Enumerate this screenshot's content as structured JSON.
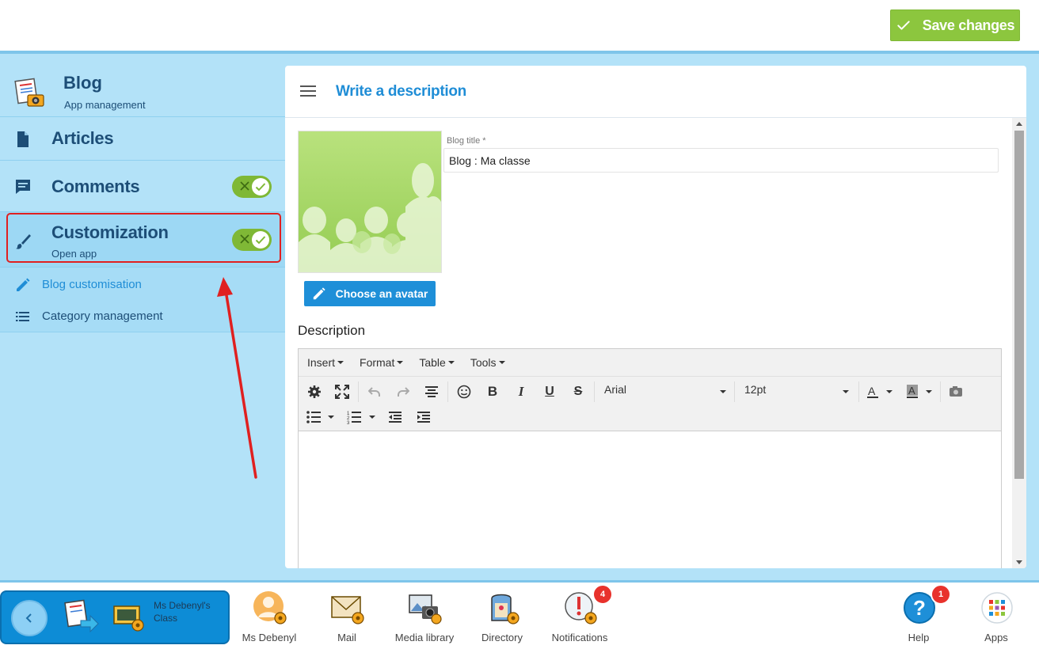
{
  "header": {
    "save_label": "Save changes"
  },
  "sidebar": {
    "app_title": "Blog",
    "app_subtitle": "App management",
    "items": [
      {
        "label": "Articles"
      },
      {
        "label": "Comments",
        "toggle_on": true
      },
      {
        "label": "Customization",
        "sublabel": "Open app",
        "toggle_on": true
      }
    ],
    "subitems": [
      {
        "label": "Blog customisation",
        "active": true
      },
      {
        "label": "Category management",
        "active": false
      }
    ]
  },
  "panel": {
    "title": "Write a description",
    "avatar_button": "Choose an avatar",
    "blog_title_label": "Blog title *",
    "blog_title_value": "Blog : Ma classe",
    "description_label": "Description"
  },
  "editor": {
    "menus": [
      "Insert",
      "Format",
      "Table",
      "Tools"
    ],
    "font_family": "Arial",
    "font_size": "12pt",
    "toolbar_icons": [
      "settings-icon",
      "fullscreen-icon",
      "undo-icon",
      "redo-icon",
      "align-center-icon",
      "emoji-icon",
      "bold-icon",
      "italic-icon",
      "underline-icon",
      "strikethrough-icon",
      "text-color-icon",
      "background-color-icon",
      "image-icon",
      "bullet-list-icon",
      "numbered-list-icon",
      "outdent-icon",
      "indent-icon"
    ]
  },
  "dock": {
    "class_name": "Ms Debenyl's Class",
    "items": [
      {
        "label": "Ms Debenyl",
        "icon": "user-avatar-icon"
      },
      {
        "label": "Mail",
        "icon": "mail-icon"
      },
      {
        "label": "Media library",
        "icon": "media-library-icon"
      },
      {
        "label": "Directory",
        "icon": "directory-icon"
      },
      {
        "label": "Notifications",
        "icon": "notifications-icon",
        "badge": "4"
      },
      {
        "label": "Help",
        "icon": "help-icon",
        "badge": "1"
      },
      {
        "label": "Apps",
        "icon": "apps-grid-icon"
      }
    ]
  },
  "colors": {
    "accent_green": "#8cc63e",
    "accent_blue": "#1f8dd6",
    "sidebar_bg": "#b3e2f8",
    "title_navy": "#1d4e77",
    "highlight_red": "#e02020"
  }
}
